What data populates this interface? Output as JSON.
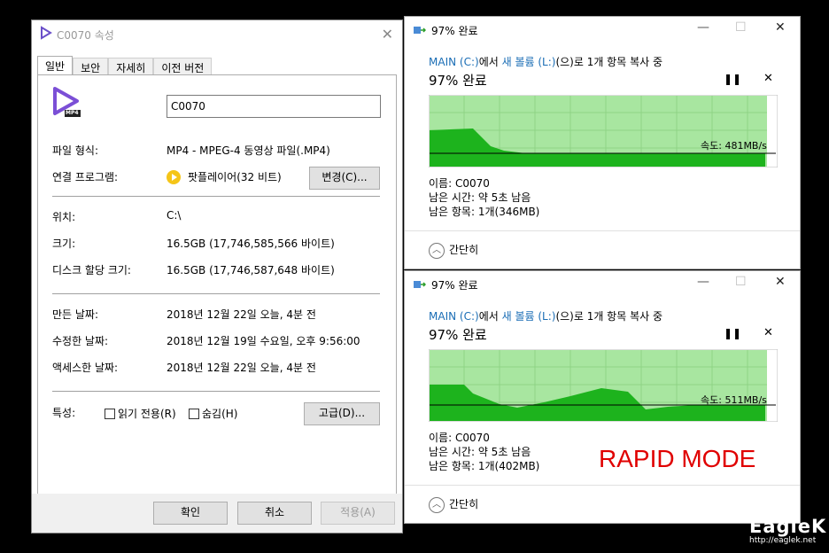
{
  "properties": {
    "title": "C0070 속성",
    "tabs": [
      "일반",
      "보안",
      "자세히",
      "이전 버전"
    ],
    "file_name": "C0070",
    "file_icon_label": "MP4",
    "rows": {
      "file_type_label": "파일 형식:",
      "file_type_value": "MP4 - MPEG-4 동영상 파일(.MP4)",
      "opens_with_label": "연결 프로그램:",
      "opens_with_value": "팟플레이어(32 비트)",
      "change_button": "변경(C)...",
      "location_label": "위치:",
      "location_value": "C:\\",
      "size_label": "크기:",
      "size_value": "16.5GB (17,746,585,566 바이트)",
      "disk_size_label": "디스크 할당 크기:",
      "disk_size_value": "16.5GB (17,746,587,648 바이트)",
      "created_label": "만든 날짜:",
      "created_value": "2018년 12월 22일 오늘, 4분 전",
      "modified_label": "수정한 날짜:",
      "modified_value": "2018년 12월 19일 수요일, 오후 9:56:00",
      "accessed_label": "액세스한 날짜:",
      "accessed_value": "2018년 12월 22일 오늘, 4분 전",
      "attributes_label": "특성:",
      "readonly_label": "읽기 전용(R)",
      "hidden_label": "숨김(H)",
      "advanced_button": "고급(D)..."
    },
    "footer": {
      "ok": "확인",
      "cancel": "취소",
      "apply": "적용(A)"
    }
  },
  "copy_dialogs": [
    {
      "title": "97% 완료",
      "source": "MAIN (C:)",
      "mid": "에서 ",
      "dest": "새 볼륨 (L:)",
      "tail": "(으)로 1개 항목 복사 중",
      "percent_label": "97% 완료",
      "progress": 0.97,
      "speed": "속도: 481MB/s",
      "name": "이름: C0070",
      "time_left": "남은 시간: 약 5초 남음",
      "items_left": "남은 항목: 1개(346MB)",
      "simple": "간단히"
    },
    {
      "title": "97% 완료",
      "source": "MAIN (C:)",
      "mid": "에서 ",
      "dest": "새 볼륨 (L:)",
      "tail": "(으)로 1개 항목 복사 중",
      "percent_label": "97% 완료",
      "progress": 0.97,
      "speed": "속도: 511MB/s",
      "name": "이름: C0070",
      "time_left": "남은 시간: 약 5초 남음",
      "items_left": "남은 항목: 1개(402MB)",
      "simple": "간단히"
    }
  ],
  "overlay": {
    "rapid_mode": "RAPID MODE"
  },
  "watermark": {
    "brand": "EagleK",
    "url": "http://eaglek.net"
  },
  "colors": {
    "graph_fill": "#1db31d",
    "graph_bg": "#a8e6a0",
    "link": "#1a6db5",
    "rapid": "#e00000"
  }
}
